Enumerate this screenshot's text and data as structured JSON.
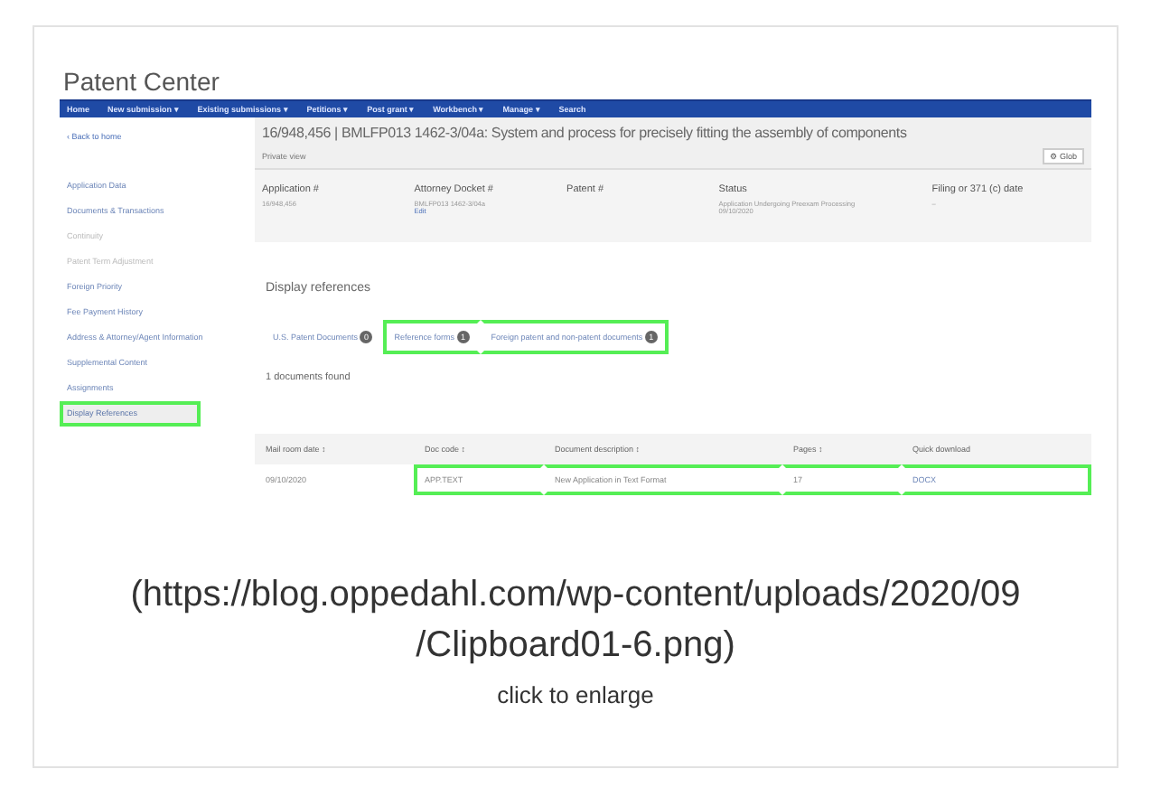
{
  "screenshot": {
    "app_title": "Patent Center",
    "nav": [
      "Home",
      "New submission ▾",
      "Existing submissions ▾",
      "Petitions ▾",
      "Post grant ▾",
      "Workbench ▾",
      "Manage ▾",
      "Search"
    ],
    "back_link": "‹ Back to home",
    "sidebar": [
      {
        "label": "Application Data",
        "selected": false,
        "highlighted": false,
        "disabled": false
      },
      {
        "label": "Documents & Transactions",
        "selected": false,
        "highlighted": false,
        "disabled": false
      },
      {
        "label": "Continuity",
        "selected": false,
        "highlighted": false,
        "disabled": true
      },
      {
        "label": "Patent Term Adjustment",
        "selected": false,
        "highlighted": false,
        "disabled": true
      },
      {
        "label": "Foreign Priority",
        "selected": false,
        "highlighted": false,
        "disabled": false
      },
      {
        "label": "Fee Payment History",
        "selected": false,
        "highlighted": false,
        "disabled": false
      },
      {
        "label": "Address & Attorney/Agent Information",
        "selected": false,
        "highlighted": false,
        "disabled": false
      },
      {
        "label": "Supplemental Content",
        "selected": false,
        "highlighted": false,
        "disabled": false
      },
      {
        "label": "Assignments",
        "selected": false,
        "highlighted": false,
        "disabled": false
      },
      {
        "label": "Display References",
        "selected": true,
        "highlighted": true,
        "disabled": false
      }
    ],
    "heading": "16/948,456 | BMLFP013 1462-3/04a: System and process for precisely fitting the assembly of components",
    "view": "Private view",
    "global_button": "⚙ Glob",
    "fields": [
      {
        "label": "Application #",
        "values": [
          "16/948,456"
        ]
      },
      {
        "label": "Attorney Docket #",
        "values": [
          "BMLFP013 1462-3/04a",
          "Edit"
        ]
      },
      {
        "label": "Patent #"
      },
      {
        "label": "Status",
        "values": [
          "Application Undergoing Preexam Processing",
          "09/10/2020"
        ]
      },
      {
        "label": "Filing or 371 (c) date",
        "values": [
          "–"
        ]
      }
    ],
    "section_title": "Display references",
    "tabs": [
      {
        "label": "U.S. Patent Documents",
        "count": "0",
        "highlighted": false
      },
      {
        "label": "Reference forms",
        "count": "1",
        "highlighted": true
      },
      {
        "label": "Foreign patent and non-patent documents",
        "count": "1",
        "highlighted": true
      }
    ],
    "found": "1 documents found",
    "table": {
      "columns": [
        "Mail room date ↕",
        "Doc code ↕",
        "Document description ↕",
        "Pages ↕",
        "Quick download"
      ],
      "rows": [
        {
          "cells": [
            {
              "text": "09/10/2020",
              "highlighted": false,
              "link": false
            },
            {
              "text": "APP.TEXT",
              "highlighted": true,
              "link": false
            },
            {
              "text": "New Application in Text Format",
              "highlighted": true,
              "link": false
            },
            {
              "text": "17",
              "highlighted": true,
              "link": false
            },
            {
              "text": "DOCX",
              "highlighted": true,
              "link": true
            }
          ]
        }
      ]
    }
  },
  "caption": {
    "link": "(https://blog.oppedahl.com/wp-content/uploads/2020/09/Clipboard01-6.png)",
    "note": "click to enlarge"
  }
}
